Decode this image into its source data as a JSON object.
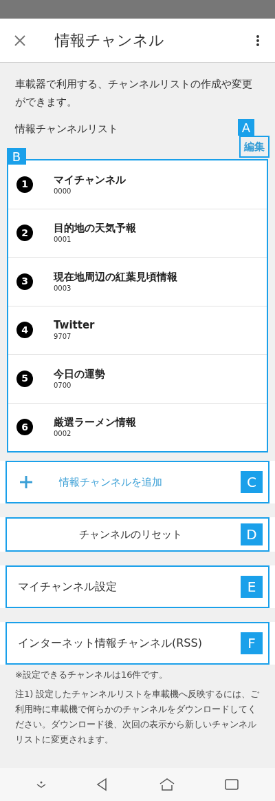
{
  "header": {
    "title": "情報チャンネル"
  },
  "description": "車載器で利用する、チャンネルリストの作成や変更ができます。",
  "list_label": "情報チャンネルリスト",
  "edit": {
    "label": "編集",
    "callout": "A"
  },
  "channel_list": {
    "callout": "B",
    "items": [
      {
        "number": "1",
        "name": "マイチャンネル",
        "code": "0000"
      },
      {
        "number": "2",
        "name": "目的地の天気予報",
        "code": "0001"
      },
      {
        "number": "3",
        "name": "現在地周辺の紅葉見頃情報",
        "code": "0003"
      },
      {
        "number": "4",
        "name": "Twitter",
        "code": "9707"
      },
      {
        "number": "5",
        "name": "今日の運勢",
        "code": "0700"
      },
      {
        "number": "6",
        "name": "厳選ラーメン情報",
        "code": "0002"
      }
    ]
  },
  "actions": [
    {
      "kind": "add",
      "label": "情報チャンネルを追加",
      "callout": "C"
    },
    {
      "kind": "center",
      "label": "チャンネルのリセット",
      "callout": "D"
    },
    {
      "kind": "plain",
      "label": "マイチャンネル設定",
      "callout": "E"
    },
    {
      "kind": "plain",
      "label": "インターネット情報チャンネル(RSS)",
      "callout": "F"
    }
  ],
  "notes": [
    "※設定できるチャンネルは16件です。",
    "注1) 設定したチャンネルリストを車載機へ反映するには、ご利用時に車載機で何らかのチャンネルをダウンロードしてください。ダウンロード後、次回の表示から新しいチャンネルリストに変更されます。"
  ]
}
